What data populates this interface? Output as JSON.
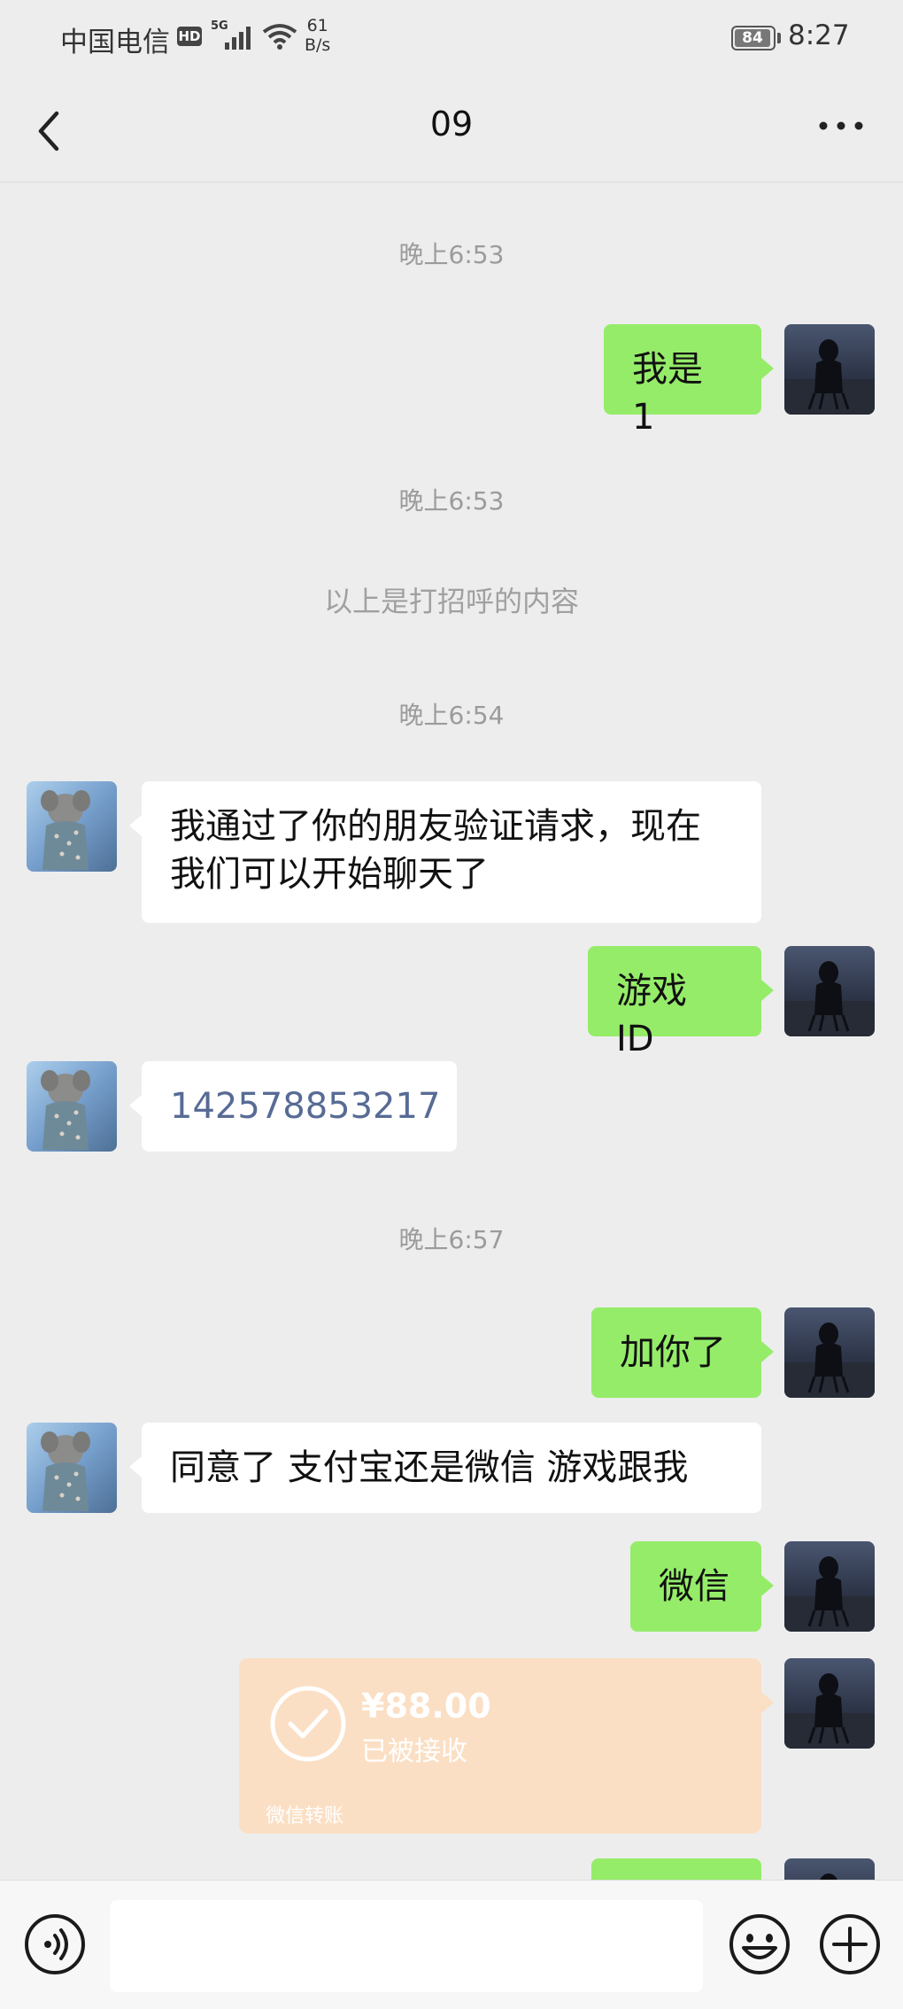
{
  "status_bar": {
    "carrier": "中国电信",
    "hd": "HD",
    "network": "5G",
    "speed_value": "61",
    "speed_unit": "B/s",
    "battery": "84",
    "time": "8:27"
  },
  "header": {
    "title": "09",
    "back_icon": "chevron-left-icon",
    "more_icon": "more-dots-icon"
  },
  "messages": [
    {
      "type": "time",
      "text": "晚上6:53"
    },
    {
      "type": "sent",
      "text": "我是 1"
    },
    {
      "type": "time",
      "text": "晚上6:53"
    },
    {
      "type": "system",
      "text": "以上是打招呼的内容"
    },
    {
      "type": "time",
      "text": "晚上6:54"
    },
    {
      "type": "received",
      "text": "我通过了你的朋友验证请求，现在我们可以开始聊天了"
    },
    {
      "type": "sent",
      "text": "游戏 ID"
    },
    {
      "type": "received",
      "text": "142578853217"
    },
    {
      "type": "time",
      "text": "晚上6:57"
    },
    {
      "type": "sent",
      "text": "加你了"
    },
    {
      "type": "received",
      "text": "同意了 支付宝还是微信  游戏跟我"
    },
    {
      "type": "sent",
      "text": "微信"
    },
    {
      "type": "transfer",
      "amount": "¥88.00",
      "status": "已被接收",
      "label": "微信转账"
    }
  ],
  "input_bar": {
    "placeholder": "",
    "icons": [
      "voice-icon",
      "emoji-icon",
      "plus-icon"
    ]
  },
  "colors": {
    "background": "#ededed",
    "sent_bubble": "#95ec69",
    "received_bubble": "#ffffff",
    "transfer_card": "#fbdfc4",
    "number_link": "#576b95"
  }
}
